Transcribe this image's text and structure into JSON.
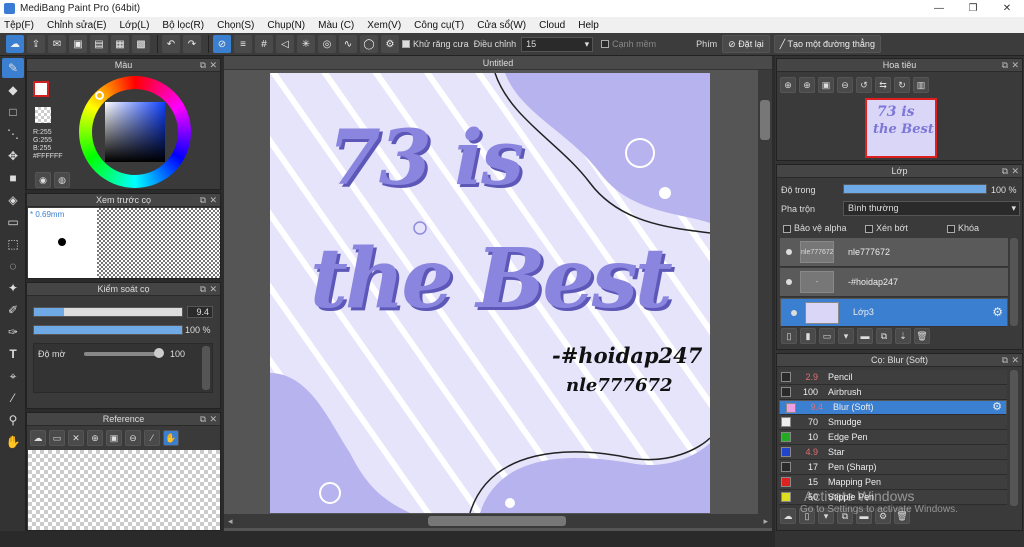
{
  "app": {
    "title": "MediBang Paint Pro (64bit)"
  },
  "window_controls": {
    "minimize": "—",
    "maximize": "❐",
    "close": "✕"
  },
  "menu": [
    "Tệp(F)",
    "Chỉnh sửa(E)",
    "Lớp(L)",
    "Bộ lọc(R)",
    "Chọn(S)",
    "Chụp(N)",
    "Màu (C)",
    "Xem(V)",
    "Công cụ(T)",
    "Cửa sổ(W)",
    "Cloud",
    "Help"
  ],
  "toolbar": {
    "antialias_label": "Khử răng cưa",
    "correction_label": "Điều chỉnh",
    "correction_value": "15",
    "soft_edge_label": "Cạnh mềm",
    "key_label": "Phím",
    "reset_label": "Đặt lại",
    "create_line_label": "Tạo một đường thẳng"
  },
  "color_panel": {
    "title": "Màu",
    "r": "R:255",
    "g": "G:255",
    "b": "B:255",
    "hex": "#FFFFFF"
  },
  "brush_preview": {
    "title": "Xem trước cọ",
    "size": "* 0.69mm"
  },
  "brush_control": {
    "title": "Kiểm soát cọ",
    "size_value": "9.4",
    "opacity_value": "100 %",
    "density_label": "Độ mờ",
    "density_value": "100",
    "size_fraction": 0.2,
    "opacity_fraction": 1.0,
    "density_fraction": 1.0
  },
  "reference": {
    "title": "Reference"
  },
  "document": {
    "tab_title": "Untitled"
  },
  "artwork": {
    "line1": "73 is",
    "line2": "the Best",
    "tag1": "-#hoidap247",
    "tag2": "nle777672"
  },
  "navigator": {
    "title": "Hoa tiêu"
  },
  "layer_panel": {
    "title": "Lớp",
    "opacity_label": "Độ trong",
    "opacity_value": "100 %",
    "opacity_fraction": 1.0,
    "blend_label": "Pha trộn",
    "blend_value": "Bình thường",
    "protect_alpha": "Bảo vệ alpha",
    "clipping": "Xén bớt",
    "lock": "Khóa",
    "layers": [
      {
        "name": "nle777672",
        "thumb": "nle777672",
        "selected": false
      },
      {
        "name": "-#hoidap247",
        "thumb": "-#hoidap247",
        "selected": false
      },
      {
        "name": "Lớp3",
        "thumb": "",
        "selected": true
      }
    ]
  },
  "brush_panel": {
    "title": "Cọ: Blur (Soft)",
    "brushes": [
      {
        "size": "2.9",
        "name": "Pencil",
        "color": "#2a2a2a",
        "size_color": "#e07070",
        "selected": false
      },
      {
        "size": "100",
        "name": "Airbrush",
        "color": "#2a2a2a",
        "size_color": "#eeeeee",
        "selected": false
      },
      {
        "size": "9.4",
        "name": "Blur (Soft)",
        "color": "#f0a0e0",
        "size_color": "#e07070",
        "selected": true
      },
      {
        "size": "70",
        "name": "Smudge",
        "color": "#eeeeee",
        "size_color": "#eeeeee",
        "selected": false
      },
      {
        "size": "10",
        "name": "Edge Pen",
        "color": "#22aa22",
        "size_color": "#eeeeee",
        "selected": false
      },
      {
        "size": "4.9",
        "name": "Star",
        "color": "#2244cc",
        "size_color": "#e07070",
        "selected": false
      },
      {
        "size": "17",
        "name": "Pen (Sharp)",
        "color": "#2a2a2a",
        "size_color": "#eeeeee",
        "selected": false
      },
      {
        "size": "15",
        "name": "Mapping Pen",
        "color": "#dd2222",
        "size_color": "#eeeeee",
        "selected": false
      },
      {
        "size": "50",
        "name": "Stipple Pen",
        "color": "#dddd22",
        "size_color": "#eeeeee",
        "selected": false
      }
    ]
  },
  "watermark": {
    "line1": "Activate Windows",
    "line2": "Go to Settings to activate Windows."
  }
}
